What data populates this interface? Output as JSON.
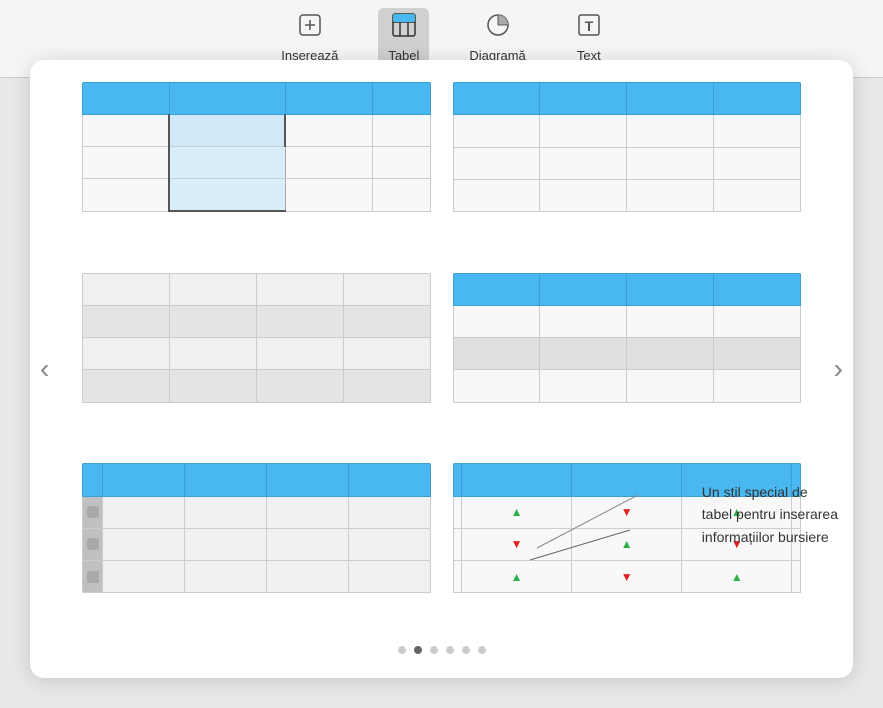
{
  "toolbar": {
    "items": [
      {
        "id": "insert",
        "label": "Inserează",
        "icon": "⊞",
        "active": false
      },
      {
        "id": "table",
        "label": "Tabel",
        "icon": "⊞",
        "active": true
      },
      {
        "id": "diagram",
        "label": "Diagramă",
        "icon": "◔",
        "active": false
      },
      {
        "id": "text",
        "label": "Text",
        "icon": "T",
        "active": false
      }
    ]
  },
  "arrows": {
    "left": "‹",
    "right": "›"
  },
  "pagination": {
    "total": 6,
    "active_index": 1
  },
  "callout": {
    "line1": "Un stil special de",
    "line2": "tabel pentru inserarea",
    "line3": "informațiilor bursiere"
  },
  "table_styles": [
    {
      "id": "style1",
      "name": "Blue header with selected column"
    },
    {
      "id": "style2",
      "name": "Blue header plain"
    },
    {
      "id": "style3",
      "name": "Plain no header"
    },
    {
      "id": "style4",
      "name": "Blue header alternating rows"
    },
    {
      "id": "style5",
      "name": "Blue header left column"
    },
    {
      "id": "style6",
      "name": "Stock table"
    }
  ]
}
